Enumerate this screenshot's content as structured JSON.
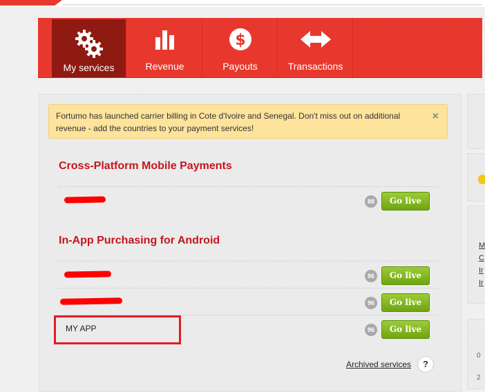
{
  "nav": {
    "items": [
      {
        "label": "My services",
        "icon": "gears-icon",
        "active": true
      },
      {
        "label": "Revenue",
        "icon": "bar-chart-icon",
        "active": false
      },
      {
        "label": "Payouts",
        "icon": "dollar-coin-icon",
        "active": false
      },
      {
        "label": "Transactions",
        "icon": "two-way-arrow-icon",
        "active": false
      }
    ]
  },
  "notice": {
    "text": "Fortumo has launched carrier billing in Cote d'Ivoire and Senegal. Don't miss out on additional revenue - add the countries to your payment services!",
    "close_glyph": "×"
  },
  "sections": [
    {
      "title": "Cross-Platform Mobile Payments",
      "services": [
        {
          "name": "",
          "redacted": true,
          "badge": "88",
          "action": "Go live"
        }
      ]
    },
    {
      "title": "In-App Purchasing for Android",
      "services": [
        {
          "name": "",
          "redacted": true,
          "badge": "96",
          "action": "Go live"
        },
        {
          "name": "",
          "redacted": true,
          "badge": "96",
          "action": "Go live"
        },
        {
          "name": "MY APP",
          "redacted": false,
          "badge": "96",
          "action": "Go live"
        }
      ]
    }
  ],
  "footer": {
    "archived_label": "Archived services",
    "help_glyph": "?"
  },
  "right_edge": {
    "links": [
      "M",
      "C",
      "Ir",
      "Ir"
    ],
    "texts": [
      "0",
      "2"
    ]
  },
  "colors": {
    "brand_red": "#e8382d",
    "active_nav": "#8f1a12",
    "section_title": "#c4161c",
    "go_live_green": "#7cb51f",
    "notice_bg": "#fde39c",
    "highlight_box": "#e31b23"
  }
}
